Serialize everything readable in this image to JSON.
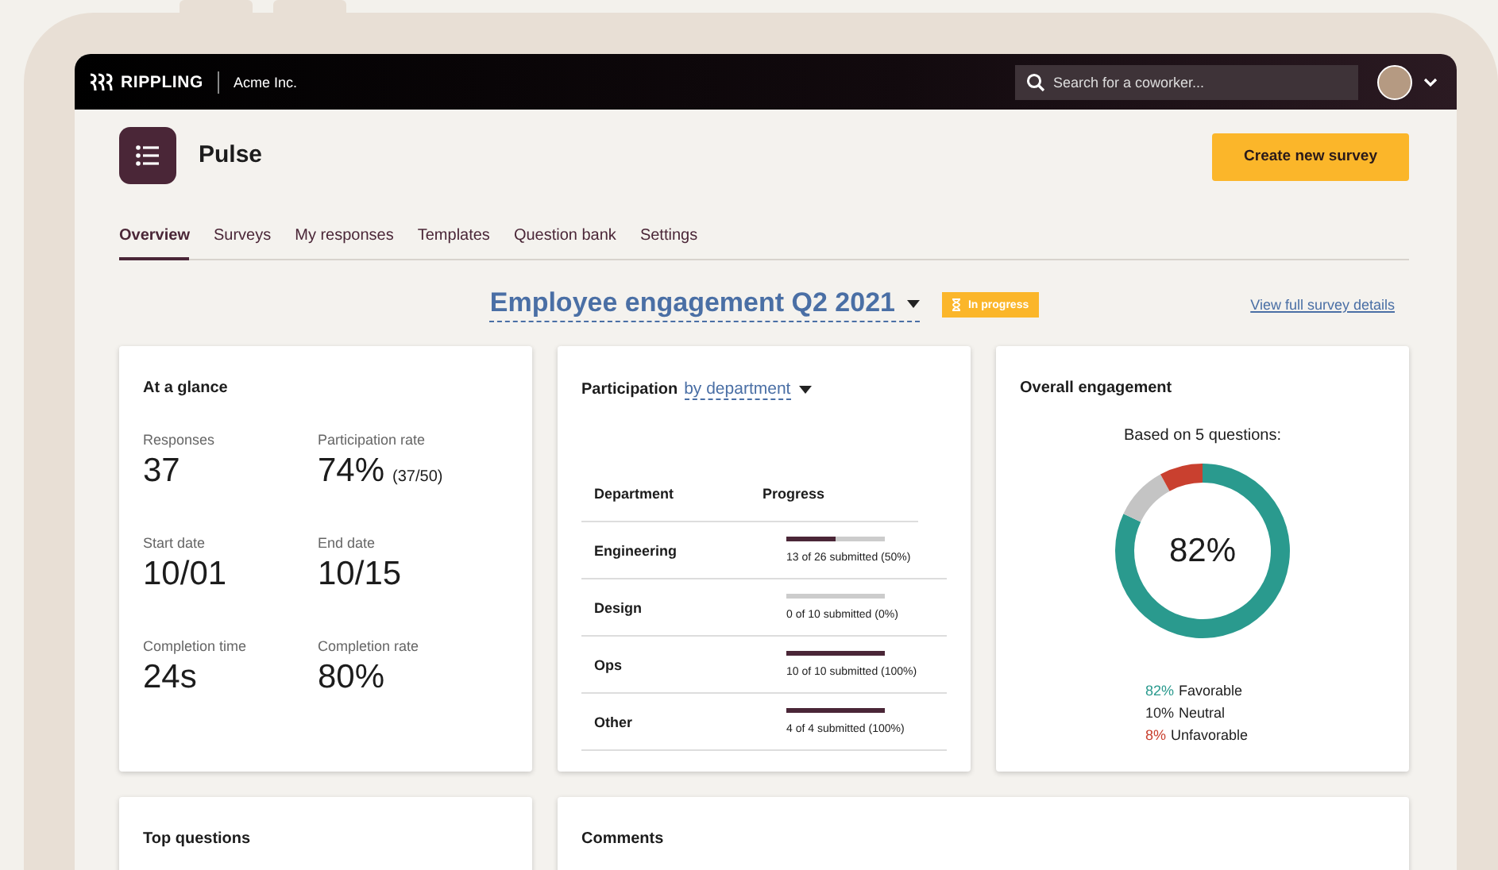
{
  "topbar": {
    "brand": "RIPPLING",
    "company": "Acme Inc.",
    "search": {
      "placeholder": "Search for a coworker..."
    }
  },
  "app": {
    "title": "Pulse",
    "action": "Create new survey"
  },
  "tabs": [
    {
      "label": "Overview",
      "selected": true
    },
    {
      "label": "Surveys",
      "selected": false
    },
    {
      "label": "My responses",
      "selected": false
    },
    {
      "label": "Templates",
      "selected": false
    },
    {
      "label": "Question bank",
      "selected": false
    },
    {
      "label": "Settings",
      "selected": false
    }
  ],
  "survey": {
    "title": "Employee engagement Q2 2021",
    "status": "In progress",
    "link": "View full survey details"
  },
  "glance": {
    "title": "At a glance",
    "stats": [
      {
        "label": "Responses",
        "value": "37"
      },
      {
        "label": "Participation rate",
        "value": "74%",
        "note": "(37/50)"
      },
      {
        "label": "Start date",
        "value": "10/01"
      },
      {
        "label": "End date",
        "value": "10/15"
      },
      {
        "label": "Completion time",
        "value": "24s"
      },
      {
        "label": "Completion rate",
        "value": "80%"
      }
    ]
  },
  "participation": {
    "title": "Participation",
    "filter": "by department",
    "columns": [
      "Department",
      "Progress"
    ],
    "rows": [
      {
        "department": "Engineering",
        "level": 0.5,
        "reading": "13 of 26 submitted (50%)"
      },
      {
        "department": "Design",
        "level": 0,
        "reading": "0 of 10 submitted (0%)"
      },
      {
        "department": "Ops",
        "level": 1,
        "reading": "10 of 10 submitted (100%)"
      },
      {
        "department": "Other",
        "level": 1,
        "reading": "4 of 4 submitted (100%)"
      }
    ]
  },
  "engagement": {
    "title": "Overall engagement",
    "subtitle": "Based on 5 questions:",
    "center_label": "82%",
    "chart_data": {
      "type": "donut",
      "categories": [
        "Favorable",
        "Neutral",
        "Unfavorable"
      ],
      "values": [
        82,
        10,
        8
      ]
    },
    "legend": [
      {
        "value": "82%",
        "color": "#2a9a8e"
      },
      {
        "value": "10%",
        "color": "#2a2a2a"
      },
      {
        "value": "8%",
        "color": "#c9402f"
      }
    ]
  },
  "bottom": {
    "left_title": "Top questions",
    "right_title": "Comments"
  }
}
